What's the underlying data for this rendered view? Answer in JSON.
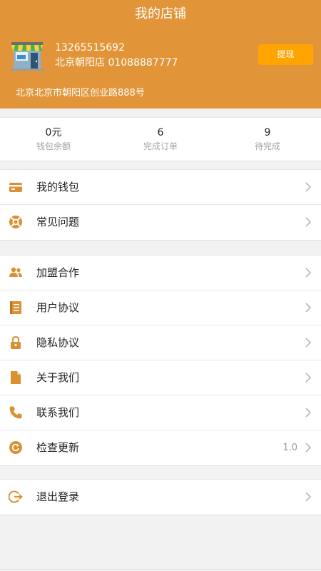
{
  "header": {
    "title": "我的店铺",
    "phone": "13265515692",
    "store_name": "北京朝阳店",
    "store_phone": "01088887777",
    "withdraw_label": "提现",
    "address": "北京北京市朝阳区创业路888号"
  },
  "stats": [
    {
      "value": "0元",
      "label": "钱包余额"
    },
    {
      "value": "6",
      "label": "完成订单"
    },
    {
      "value": "9",
      "label": "待完成"
    }
  ],
  "menu_group_1": [
    {
      "icon": "wallet-icon",
      "label": "我的钱包"
    },
    {
      "icon": "help-icon",
      "label": "常见问题"
    }
  ],
  "menu_group_2": [
    {
      "icon": "users-icon",
      "label": "加盟合作"
    },
    {
      "icon": "document-icon",
      "label": "用户协议"
    },
    {
      "icon": "lock-icon",
      "label": "隐私协议"
    },
    {
      "icon": "file-icon",
      "label": "关于我们"
    },
    {
      "icon": "phone-icon",
      "label": "联系我们"
    },
    {
      "icon": "refresh-icon",
      "label": "检查更新",
      "value": "1.0"
    }
  ],
  "menu_group_3": [
    {
      "icon": "logout-icon",
      "label": "退出登录"
    }
  ],
  "colors": {
    "header_bg": "#e29438",
    "withdraw_button": "#ffa400",
    "icon": "#d99133",
    "page_bg": "#f2f2f2"
  }
}
